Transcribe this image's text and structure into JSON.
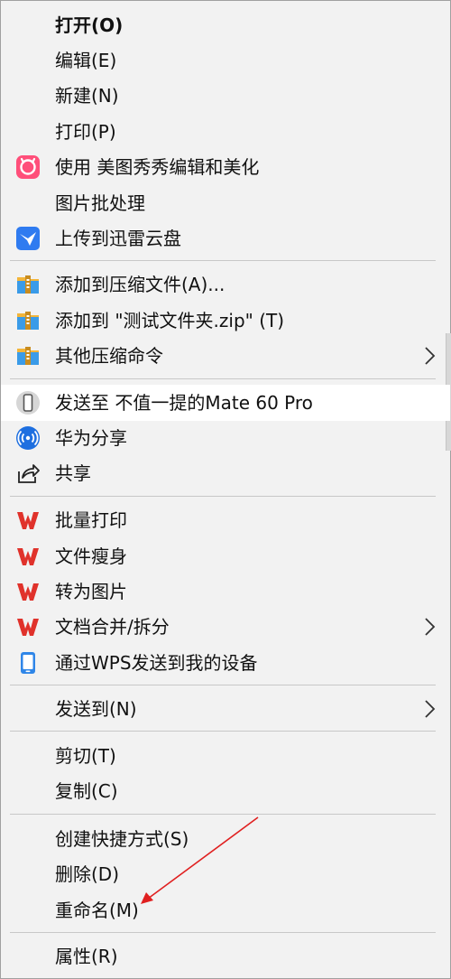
{
  "menu": {
    "items": [
      {
        "label": "打开(O)",
        "icon": "none",
        "bold": true
      },
      {
        "label": "编辑(E)",
        "icon": "none"
      },
      {
        "label": "新建(N)",
        "icon": "none"
      },
      {
        "label": "打印(P)",
        "icon": "none"
      },
      {
        "label": "使用 美图秀秀编辑和美化",
        "icon": "meitu-icon"
      },
      {
        "label": "图片批处理",
        "icon": "none"
      },
      {
        "label": "上传到迅雷云盘",
        "icon": "xunlei-icon"
      },
      {
        "label": "添加到压缩文件(A)...",
        "icon": "archive-icon"
      },
      {
        "label": "添加到 \"测试文件夹.zip\" (T)",
        "icon": "archive-icon"
      },
      {
        "label": "其他压缩命令",
        "icon": "archive-icon",
        "submenu": true
      },
      {
        "label": "发送至 不值一提的Mate 60 Pro",
        "icon": "phone-icon",
        "highlighted": true
      },
      {
        "label": "华为分享",
        "icon": "huawei-share-icon"
      },
      {
        "label": "共享",
        "icon": "share-icon"
      },
      {
        "label": "批量打印",
        "icon": "wps-icon"
      },
      {
        "label": "文件瘦身",
        "icon": "wps-icon"
      },
      {
        "label": "转为图片",
        "icon": "wps-icon"
      },
      {
        "label": "文档合并/拆分",
        "icon": "wps-icon",
        "submenu": true
      },
      {
        "label": "通过WPS发送到我的设备",
        "icon": "device-icon"
      },
      {
        "label": "发送到(N)",
        "icon": "none",
        "submenu": true
      },
      {
        "label": "剪切(T)",
        "icon": "none"
      },
      {
        "label": "复制(C)",
        "icon": "none"
      },
      {
        "label": "创建快捷方式(S)",
        "icon": "none"
      },
      {
        "label": "删除(D)",
        "icon": "none"
      },
      {
        "label": "重命名(M)",
        "icon": "none"
      },
      {
        "label": "属性(R)",
        "icon": "none"
      }
    ]
  },
  "colors": {
    "menu_bg": "#f2f2f2",
    "highlight_bg": "#ffffff",
    "separator": "#c8c8c8",
    "wps_red": "#e0322b",
    "meitu_pink": "#ff4f7a",
    "xunlei_blue": "#2f7bf0",
    "huawei_blue": "#1e6fe0",
    "annotation_arrow": "#e02020"
  }
}
